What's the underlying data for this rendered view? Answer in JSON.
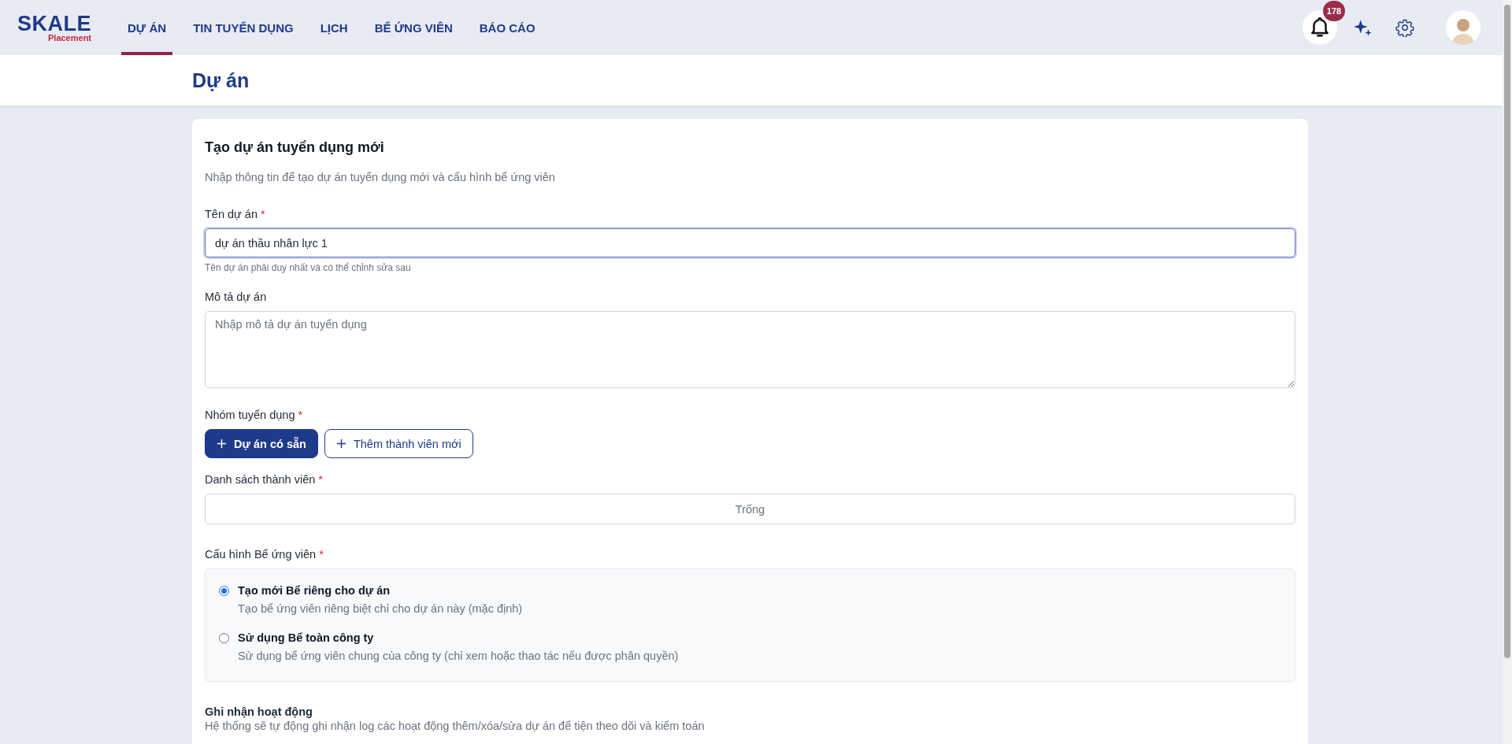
{
  "logo": {
    "name": "SKALE",
    "tagline": "Placement"
  },
  "nav": [
    {
      "label": "DỰ ÁN",
      "selected": true
    },
    {
      "label": "TIN TUYỂN DỤNG",
      "selected": false
    },
    {
      "label": "LỊCH",
      "selected": false
    },
    {
      "label": "BỂ ỨNG VIÊN",
      "selected": false
    },
    {
      "label": "BÁO CÁO",
      "selected": false
    }
  ],
  "notifications": {
    "count": "178"
  },
  "page_title": "Dự án",
  "form": {
    "title": "Tạo dự án tuyển dụng mới",
    "subtitle": "Nhập thông tin để tạo dự án tuyển dụng mới và cấu hình bể ứng viên",
    "name_field": {
      "label": "Tên dự án",
      "required_mark": "*",
      "value": "dự án thầu nhân lực 1",
      "help": "Tên dự án phải duy nhất và có thể chỉnh sửa sau",
      "focused": true
    },
    "description_field": {
      "label": "Mô tả dự án",
      "placeholder": "Nhập mô tả dự án tuyển dụng"
    },
    "team": {
      "label": "Nhóm tuyển dụng",
      "required_mark": "*",
      "buttons": [
        {
          "label": "Dự án có sẵn",
          "kind": "primary"
        },
        {
          "label": "Thêm thành viên mới",
          "kind": "outline"
        }
      ]
    },
    "members": {
      "label": "Danh sách thành viên",
      "required_mark": "*",
      "empty_text": "Trống"
    },
    "pool_config": {
      "label": "Cấu hình Bể ứng viên",
      "required_mark": "*",
      "options": [
        {
          "title": "Tạo mới Bể riêng cho dự án",
          "description": "Tạo bể ứng viên riêng biệt chỉ cho dự án này (mặc định)",
          "selected": true
        },
        {
          "title": "Sử dụng Bể toàn công ty",
          "description": "Sử dụng bể ứng viên chung của công ty (chỉ xem hoặc thao tác nếu được phân quyền)",
          "selected": false
        }
      ]
    },
    "activity": {
      "title": "Ghi nhận hoạt động",
      "description": "Hệ thống sẽ tự động ghi nhận log các hoạt động thêm/xóa/sửa dự án để tiện theo dõi và kiểm toán"
    }
  }
}
